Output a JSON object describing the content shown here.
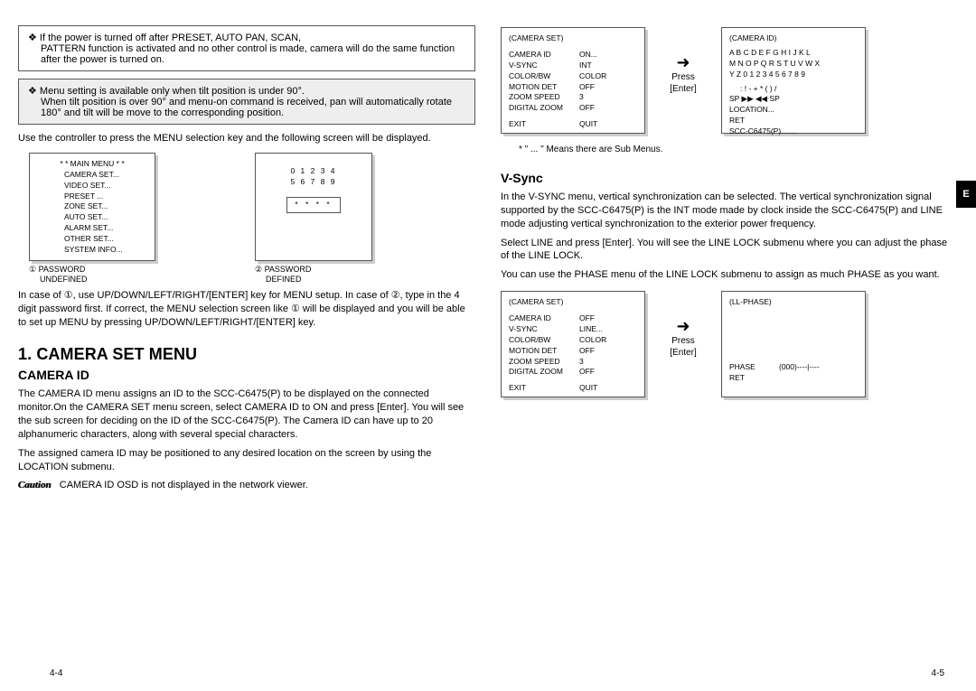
{
  "left": {
    "tip1_l1": "❖ If the power is turned off after PRESET, AUTO PAN, SCAN,",
    "tip1_l2": "PATTERN function is activated and no other control is made, camera will do the same function after the power is turned on.",
    "tip2_l1": "❖ Menu setting is available only when tilt position is under 90°.",
    "tip2_l2": "When tilt position is over 90° and menu-on command is received, pan will automatically rotate 180° and tilt will be move to the corresponding position.",
    "para1": "Use the controller to press the MENU selection key and the following screen will be displayed.",
    "mainmenu": {
      "title": "* * MAIN MENU * *",
      "items": [
        "CAMERA SET...",
        "VIDEO SET...",
        "PRESET ...",
        "ZONE SET...",
        "AUTO SET...",
        "ALARM SET...",
        "OTHER SET...",
        "SYSTEM INFO..."
      ]
    },
    "pwbox": {
      "row1": "0   1   2   3   4",
      "row2": "5   6   7   8   9",
      "stars": "* * * *"
    },
    "cap1": "① PASSWORD",
    "cap1b": "UNDEFINED",
    "cap2": "② PASSWORD",
    "cap2b": "DEFINED",
    "para2": "In case of ①, use UP/DOWN/LEFT/RIGHT/[ENTER] key for MENU setup. In case of ②, type in the 4 digit password first. If correct, the MENU selection screen like ① will be displayed and you will be able to set up MENU by pressing UP/DOWN/LEFT/RIGHT/[ENTER] key.",
    "h1": "1. CAMERA SET MENU",
    "h2": "CAMERA ID",
    "para3": "The CAMERA ID menu assigns an ID to the SCC-C6475(P) to be displayed on the connected monitor.On the CAMERA SET menu screen, select CAMERA ID to ON and press [Enter].  You will see the sub screen for deciding on the ID of the SCC-C6475(P).   The Camera ID can have up to 20 alphanumeric characters, along with several special characters.",
    "para3b": "The assigned camera ID may be positioned to any desired location on the screen by using the LOCATION submenu.",
    "caution_label": "Caution",
    "caution_text": "CAMERA ID OSD is not displayed in the network viewer."
  },
  "right": {
    "camset1": {
      "title": "(CAMERA SET)",
      "rows": [
        [
          "CAMERA ID",
          "ON..."
        ],
        [
          "V-SYNC",
          "INT"
        ],
        [
          "COLOR/BW",
          "COLOR"
        ],
        [
          "MOTION DET",
          "OFF"
        ],
        [
          "ZOOM SPEED",
          "3"
        ],
        [
          "DIGITAL ZOOM",
          "OFF"
        ]
      ],
      "footer": [
        "EXIT",
        "QUIT"
      ]
    },
    "arrow1_press": "Press",
    "arrow1_enter": "[Enter]",
    "camid": {
      "title": "(CAMERA ID)",
      "l1": "A B C D E F G H I J K L",
      "l2": "M N O P Q R S T U V W X",
      "l3": "Y Z 0 1 2 3 4 5 6 7 8 9",
      "l4": ": ! - + * ( ) /",
      "l5": "SP ▶▶ ◀◀ SP",
      "l6": "LOCATION...",
      "l7": "RET",
      "l8": "SCC-C6475(P)........"
    },
    "note1": "*  \" ... \"  Means there are Sub Menus.",
    "h2": "V-Sync",
    "p1": "In the V-SYNC menu, vertical synchronization can be selected.  The vertical synchronization signal supported by the  SCC-C6475(P) is the INT mode made by clock inside the SCC-C6475(P) and LINE mode adjusting vertical synchronization to the exterior power frequency.",
    "p2": "Select LINE and press [Enter].  You will see the LINE LOCK submenu where you can adjust the phase of the LINE LOCK.",
    "p3": "You can use the PHASE menu of the LINE LOCK submenu to assign as much PHASE as you want.",
    "camset2": {
      "title": "(CAMERA SET)",
      "rows": [
        [
          "CAMERA ID",
          "OFF"
        ],
        [
          "V-SYNC",
          "LINE..."
        ],
        [
          "COLOR/BW",
          "COLOR"
        ],
        [
          "MOTION DET",
          "OFF"
        ],
        [
          "ZOOM SPEED",
          "3"
        ],
        [
          "DIGITAL ZOOM",
          "OFF"
        ]
      ],
      "footer": [
        "EXIT",
        "QUIT"
      ]
    },
    "arrow2_press": "Press",
    "arrow2_enter": "[Enter]",
    "llphase": {
      "title": "(LL-PHASE)",
      "row": [
        "PHASE",
        "(000)----|----"
      ],
      "ret": "RET"
    }
  },
  "pg_left": "4-4",
  "pg_right": "4-5",
  "side": "E"
}
